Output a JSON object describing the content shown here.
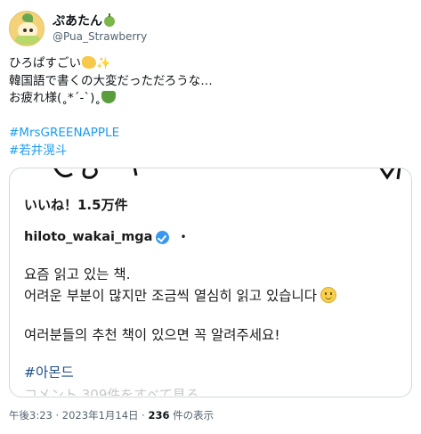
{
  "author": {
    "display_name": "ぷあたん",
    "handle": "@Pua_Strawberry"
  },
  "tweet": {
    "line1": "ひろぱすごい",
    "line2": "韓国語で書くの大変だっただろうな…",
    "line3": "お疲れ様(˳*´-`)˳",
    "hashtag1": "#MrsGREENAPPLE",
    "hashtag2": "#若井滉斗"
  },
  "embedded_post": {
    "likes": "いいね！1.5万件",
    "account": "hiloto_wakai_mga",
    "separator": "•",
    "caption_line1": "요즘 읽고 있는 책.",
    "caption_line2": "어려운 부분이 많지만 조금씩 열심히 읽고 있습니다",
    "caption_line3": "여러분들의 추천 책이 있으면 꼭 알려주세요!",
    "hashtag": "#아몬드",
    "truncated_line": "コメント 309件をすべて見る"
  },
  "meta": {
    "time": "午後3:23",
    "sep1": " · ",
    "date": "2023年1月14日",
    "sep2": " · ",
    "views_count": "236",
    "views_label": " 件の表示"
  },
  "icons": [
    "avatar",
    "green-apple-icon",
    "clapping-hands-icon",
    "sparkles-icon",
    "matcha-icon",
    "verified-badge-icon",
    "smiling-face-icon"
  ],
  "colors": {
    "link": "#1d9bf0",
    "muted": "#536471",
    "border": "#cfd9de",
    "verified": "#3897f0",
    "ig_hashtag": "#1f4f8a"
  }
}
